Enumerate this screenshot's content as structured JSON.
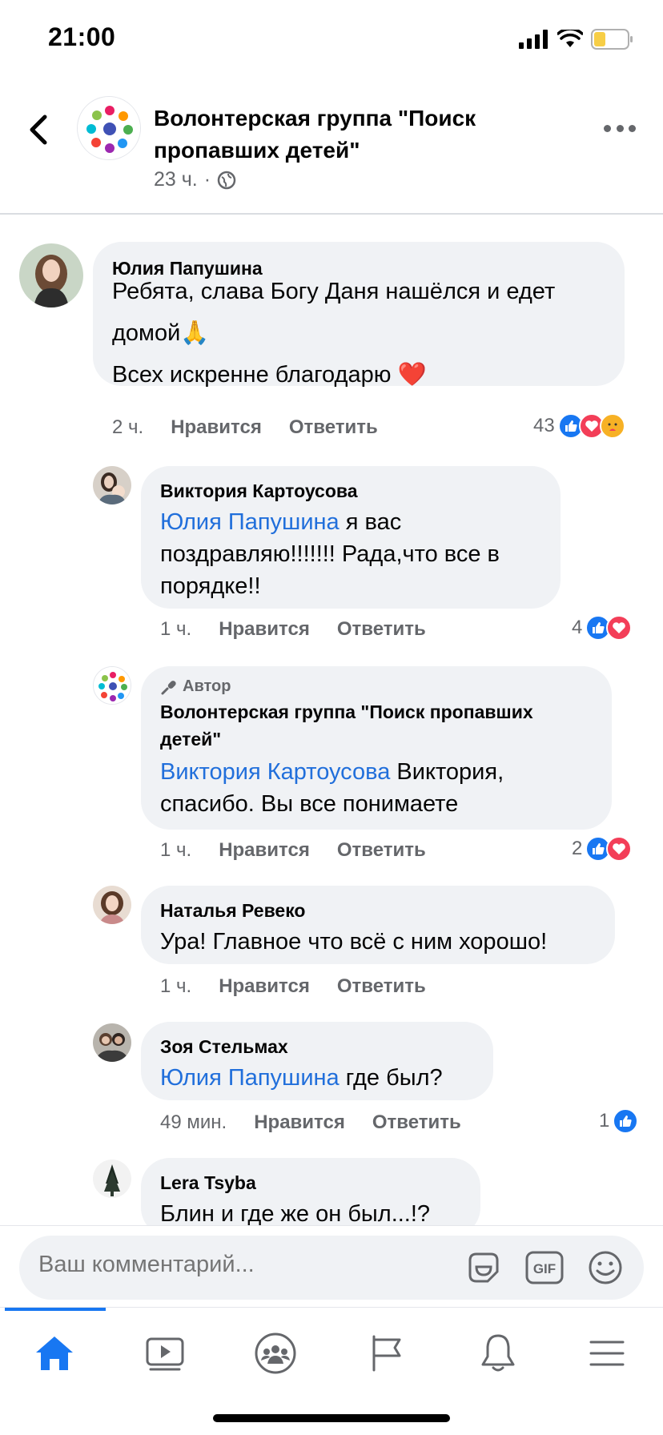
{
  "status_bar": {
    "time": "21:00"
  },
  "header": {
    "title": "Волонтерская группа \"Поиск пропавших детей\"",
    "time_ago": "23 ч.",
    "separator": "·"
  },
  "comments": [
    {
      "author": "Юлия Папушина",
      "line1": "Ребята, слава Богу Даня нашёлся и едет",
      "line2": "домой🙏",
      "line3": "Всех искренне благодарю ❤️",
      "time": "2 ч.",
      "like_label": "Нравится",
      "reply_label": "Ответить",
      "reaction_count": "43"
    },
    {
      "author": "Виктория Картоусова",
      "mention": "Юлия Папушина",
      "text_after_mention": " я вас",
      "line2": "поздравляю!!!!!!! Рада,что все в",
      "line3": "порядке!!",
      "time": "1 ч.",
      "like_label": "Нравится",
      "reply_label": "Ответить",
      "reaction_count": "4"
    },
    {
      "badge": "Автор",
      "author_line1": "Волонтерская группа \"Поиск пропавших",
      "author_line2": "детей\"",
      "mention": "Виктория Картоусова",
      "text_after_mention": " Виктория,",
      "line2": "спасибо. Вы все понимаете",
      "time": "1 ч.",
      "like_label": "Нравится",
      "reply_label": "Ответить",
      "reaction_count": "2"
    },
    {
      "author": "Наталья Ревеко",
      "text": "Ура! Главное что всё с ним хорошо!",
      "time": "1 ч.",
      "like_label": "Нравится",
      "reply_label": "Ответить"
    },
    {
      "author": "Зоя Стельмах",
      "mention": "Юлия Папушина",
      "text_after_mention": " где был?",
      "time": "49 мин.",
      "like_label": "Нравится",
      "reply_label": "Ответить",
      "reaction_count": "1"
    },
    {
      "author": "Lera Tsyba",
      "text": "Блин и где же он был...!?"
    }
  ],
  "composer": {
    "placeholder": "Ваш комментарий..."
  },
  "colors": {
    "accent": "#1877f2",
    "mention": "#216fdb",
    "love": "#f33e58",
    "bubble": "#f0f2f5"
  },
  "icons": [
    "back-icon",
    "more-icon",
    "globe-icon",
    "sticker-icon",
    "gif-icon",
    "emoji-icon",
    "home-icon",
    "video-icon",
    "groups-icon",
    "pages-flag-icon",
    "bell-icon",
    "menu-icon"
  ]
}
